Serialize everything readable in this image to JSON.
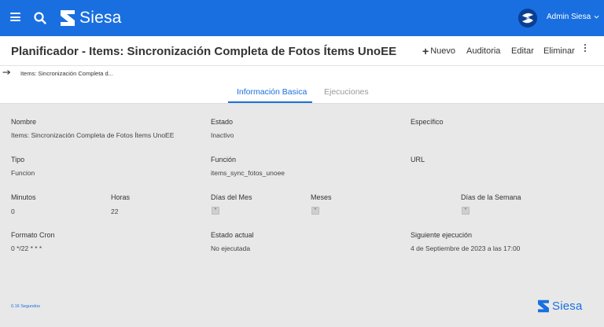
{
  "brand": {
    "name": "Siesa",
    "color": "#1a6fe0"
  },
  "header": {
    "user_name": "Admin Siesa",
    "menu_icon": "hamburger-icon",
    "search_icon": "search-icon"
  },
  "page": {
    "title": "Planificador - Items: Sincronización Completa de Fotos Ítems UnoEE"
  },
  "actions": {
    "nuevo": "Nuevo",
    "auditoria": "Auditoria",
    "editar": "Editar",
    "eliminar": "Eliminar"
  },
  "breadcrumb": {
    "text": "Items: Sincronización Completa d..."
  },
  "tabs": [
    {
      "label": "Información Basica",
      "active": true
    },
    {
      "label": "Ejecuciones",
      "active": false
    }
  ],
  "fields": {
    "nombre": {
      "label": "Nombre",
      "value": "Items: Sincronización Completa de Fotos Ítems UnoEE"
    },
    "estado": {
      "label": "Estado",
      "value": "Inactivo"
    },
    "especifico": {
      "label": "Específico",
      "value": ""
    },
    "tipo": {
      "label": "Tipo",
      "value": "Funcion"
    },
    "funcion": {
      "label": "Función",
      "value": "items_sync_fotos_unoee"
    },
    "url": {
      "label": "URL",
      "value": ""
    },
    "minutos": {
      "label": "Minutos",
      "value": "0"
    },
    "horas": {
      "label": "Horas",
      "value": "22"
    },
    "dias_mes": {
      "label": "Días del Mes",
      "value": "*"
    },
    "meses": {
      "label": "Meses",
      "value": "*"
    },
    "dias_semana": {
      "label": "Días de la Semana",
      "value": "*"
    },
    "formato_cron": {
      "label": "Formato Cron",
      "value": "0 */22 * * *"
    },
    "estado_actual": {
      "label": "Estado actual",
      "value": "No ejecutada"
    },
    "siguiente": {
      "label": "Siguiente ejecución",
      "value": "4 de Septiembre de 2023 a las 17:00"
    }
  },
  "footer": {
    "timing": "0.16 Segundos",
    "logo": "Siesa"
  }
}
